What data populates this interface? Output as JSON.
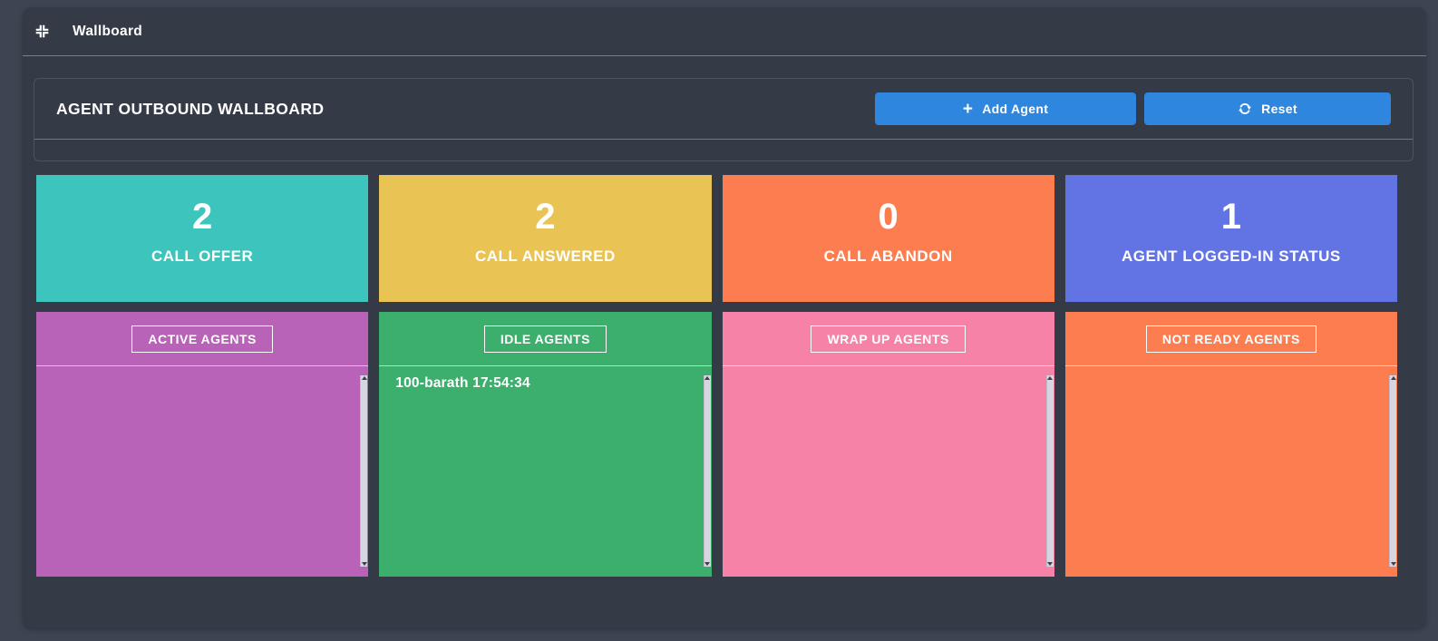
{
  "navbar": {
    "title": "Wallboard"
  },
  "wallboard": {
    "title": "AGENT OUTBOUND WALLBOARD",
    "buttons": {
      "add_agent": "Add Agent",
      "reset": "Reset"
    }
  },
  "stats": [
    {
      "value": "2",
      "label": "CALL OFFER",
      "color": "#3dc4bc"
    },
    {
      "value": "2",
      "label": "CALL ANSWERED",
      "color": "#e9c455"
    },
    {
      "value": "0",
      "label": "CALL ABANDON",
      "color": "#fc7e50"
    },
    {
      "value": "1",
      "label": "AGENT LOGGED-IN STATUS",
      "color": "#6273e4"
    }
  ],
  "agent_panels": [
    {
      "label": "ACTIVE AGENTS",
      "color": "#b863b8",
      "entries": []
    },
    {
      "label": "IDLE AGENTS",
      "color": "#3caf6d",
      "entries": [
        "100-barath 17:54:34"
      ]
    },
    {
      "label": "WRAP UP AGENTS",
      "color": "#f782a7",
      "entries": []
    },
    {
      "label": "NOT READY AGENTS",
      "color": "#fc7e50",
      "entries": []
    }
  ],
  "theme": {
    "page_background": "#3e4552",
    "container_background": "#343b47",
    "button_background": "#2e86de",
    "scrollbar_track": "#d7d6e0"
  }
}
